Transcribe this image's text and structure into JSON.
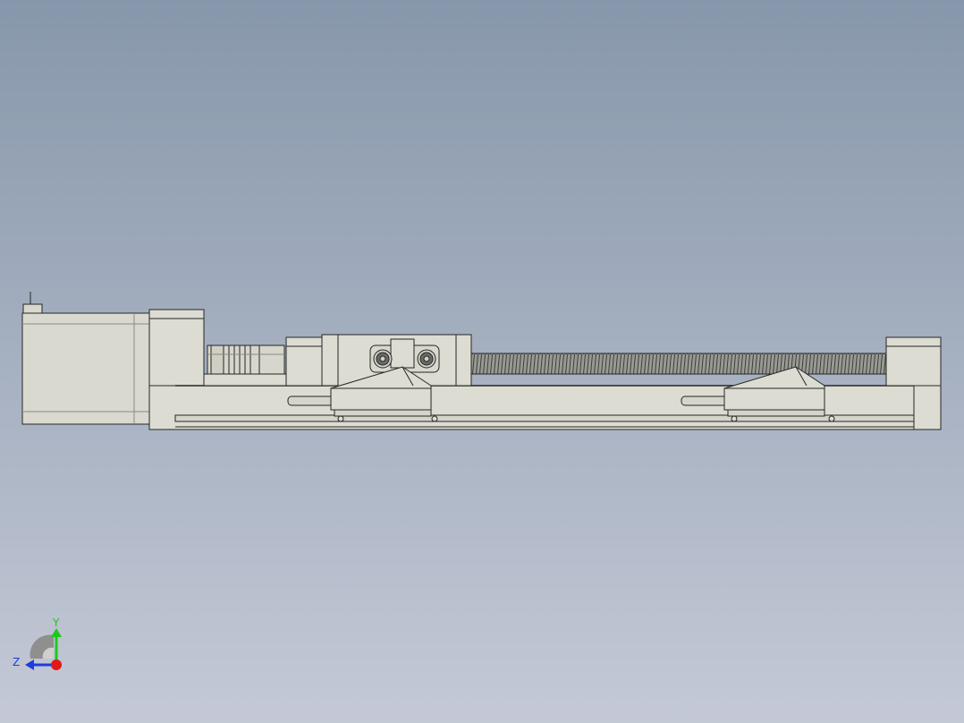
{
  "viewport": {
    "background_top": "#8797ab",
    "background_bottom": "#c4c9d6"
  },
  "model": {
    "name": "linear actuator",
    "body_color": "#dcdcd2",
    "edge_color": "#262626",
    "screw_color": "#4a4a4a"
  },
  "triad": {
    "y_label": "Y",
    "z_label": "Z",
    "y_color": "#1ec81e",
    "z_color": "#1e3cdc",
    "origin_color": "#e01818"
  }
}
